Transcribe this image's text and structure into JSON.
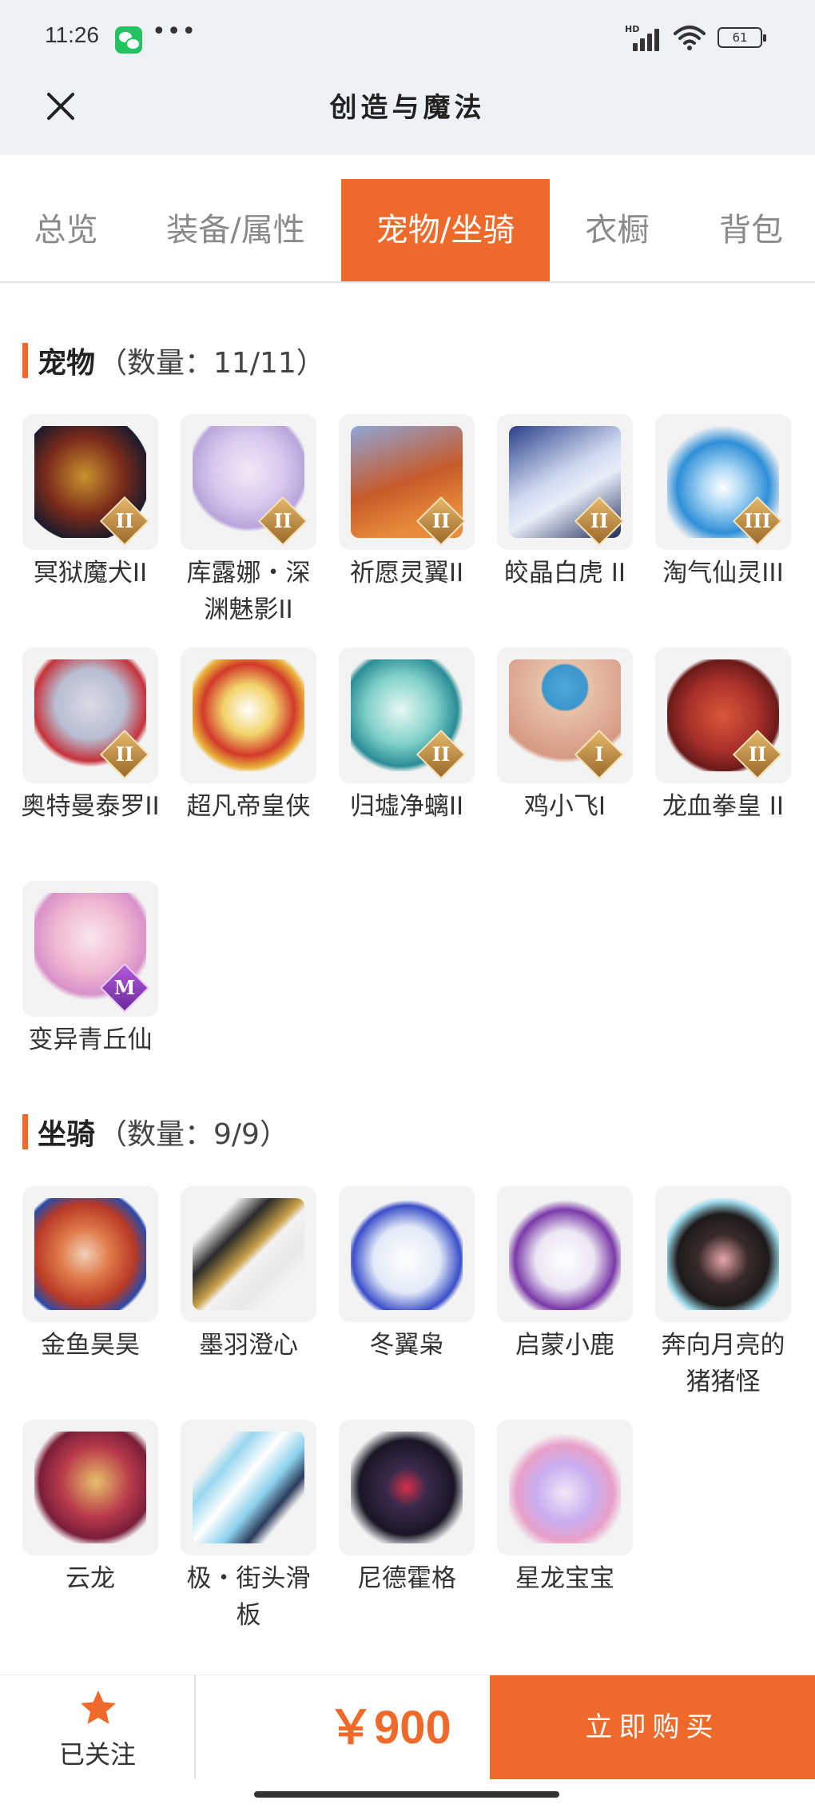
{
  "status_bar": {
    "time": "11:26",
    "more": "•••",
    "network": "HD",
    "battery": "61"
  },
  "header": {
    "title": "创造与魔法"
  },
  "tabs": [
    {
      "label": "总览",
      "active": false
    },
    {
      "label": "装备/属性",
      "active": false
    },
    {
      "label": "宠物/坐骑",
      "active": true
    },
    {
      "label": "衣橱",
      "active": false
    },
    {
      "label": "背包",
      "active": false
    }
  ],
  "pets": {
    "title": "宠物",
    "count": "（数量：11/11）",
    "items": [
      {
        "name": "冥狱魔犬II",
        "badge": "II",
        "badge_color": "gold"
      },
      {
        "name": "库露娜・深渊魅影II",
        "badge": "II",
        "badge_color": "gold"
      },
      {
        "name": "祈愿灵翼II",
        "badge": "II",
        "badge_color": "gold"
      },
      {
        "name": "皎晶白虎 II",
        "badge": "II",
        "badge_color": "gold"
      },
      {
        "name": "淘气仙灵III",
        "badge": "III",
        "badge_color": "gold"
      },
      {
        "name": "奥特曼泰罗II",
        "badge": "II",
        "badge_color": "gold"
      },
      {
        "name": "超凡帝皇侠",
        "badge": "",
        "badge_color": ""
      },
      {
        "name": "归墟净螭II",
        "badge": "II",
        "badge_color": "gold"
      },
      {
        "name": "鸡小飞I",
        "badge": "I",
        "badge_color": "gold"
      },
      {
        "name": "龙血拳皇 II",
        "badge": "II",
        "badge_color": "gold"
      },
      {
        "name": "变异青丘仙",
        "badge": "M",
        "badge_color": "purple"
      }
    ]
  },
  "mounts": {
    "title": "坐骑",
    "count": "（数量：9/9）",
    "items": [
      {
        "name": "金鱼昊昊"
      },
      {
        "name": "墨羽澄心"
      },
      {
        "name": "冬翼枭"
      },
      {
        "name": "启蒙小鹿"
      },
      {
        "name": "奔向月亮的猪猪怪"
      },
      {
        "name": "云龙"
      },
      {
        "name": "极・街头滑板"
      },
      {
        "name": "尼德霍格"
      },
      {
        "name": "星龙宝宝"
      }
    ]
  },
  "footer": {
    "follow_label": "已关注",
    "price": "￥900",
    "buy_label": "立即购买"
  },
  "colors": {
    "accent": "#ef6a2a",
    "header_bg": "#eef2f6"
  }
}
